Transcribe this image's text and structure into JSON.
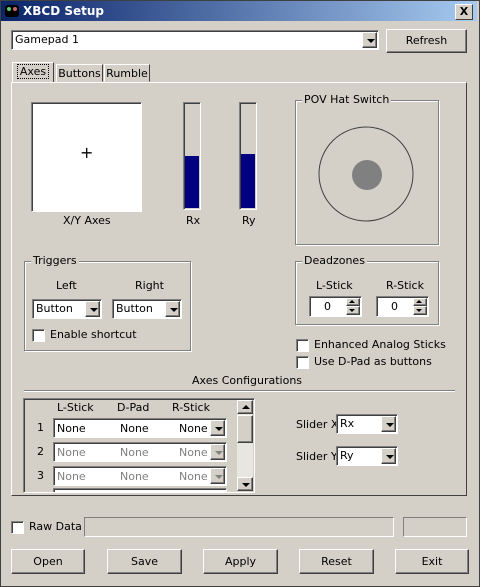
{
  "window": {
    "title": "XBCD Setup",
    "close_glyph": "X"
  },
  "device": {
    "selected": "Gamepad 1",
    "refresh_label": "Refresh"
  },
  "tabs": [
    {
      "label": "Axes"
    },
    {
      "label": "Buttons"
    },
    {
      "label": "Rumble"
    }
  ],
  "axes": {
    "xy_label": "X/Y Axes",
    "crosshair": "+",
    "rx_label": "Rx",
    "ry_label": "Ry",
    "rx_level": 0.5,
    "ry_level": 0.52,
    "pov_label": "POV Hat Switch"
  },
  "triggers": {
    "group_label": "Triggers",
    "left_label": "Left",
    "right_label": "Right",
    "left_value": "Button",
    "right_value": "Button",
    "shortcut_label": "Enable shortcut"
  },
  "deadzones": {
    "group_label": "Deadzones",
    "lstick_label": "L-Stick",
    "rstick_label": "R-Stick",
    "lstick_value": "0",
    "rstick_value": "0"
  },
  "options": {
    "enhanced_label": "Enhanced Analog Sticks",
    "dpad_label": "Use D-Pad as buttons"
  },
  "axes_config": {
    "heading": "Axes Configurations",
    "columns": [
      "L-Stick",
      "D-Pad",
      "R-Stick"
    ],
    "rows": [
      {
        "num": "1",
        "lstick": "None",
        "dpad": "None",
        "rstick": "None"
      },
      {
        "num": "2",
        "lstick": "None",
        "dpad": "None",
        "rstick": "None"
      },
      {
        "num": "3",
        "lstick": "None",
        "dpad": "None",
        "rstick": "None"
      }
    ]
  },
  "sliders": {
    "x_label": "Slider X",
    "x_value": "Rx",
    "y_label": "Slider Y",
    "y_value": "Ry"
  },
  "raw_data_label": "Raw Data",
  "buttons": {
    "open": "Open",
    "save": "Save",
    "apply": "Apply",
    "reset": "Reset",
    "exit": "Exit"
  },
  "colors": {
    "title_bar": "#0a246a",
    "bar_fill": "#000080",
    "pov_dot": "#808080"
  }
}
